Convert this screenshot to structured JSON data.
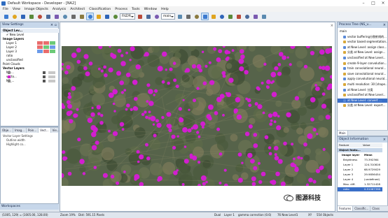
{
  "window": {
    "title": "Default Workspace - Developer - [NA2]",
    "controls": [
      "–",
      "□",
      "×"
    ]
  },
  "menu": [
    "File",
    "View",
    "Image Objects",
    "Analysis",
    "Architect",
    "Classification",
    "Process",
    "Tools",
    "Window",
    "Help"
  ],
  "toolbar": {
    "zoom_value": "FitZ/R",
    "mode_value": "main",
    "icons": [
      "new-workspace-icon",
      "open-icon",
      "save-icon",
      "import-icon",
      "export-icon",
      "undo-icon",
      "cut-icon",
      "copy-icon",
      "paste-icon",
      "settings-icon",
      "cursor-icon",
      "pan-hand-icon",
      "zoom-in-icon",
      "zoom-out-icon",
      "zoom-area-icon",
      "zoom-fit-icon",
      "refresh-icon",
      "layer-mixing-icon",
      "vector-icon",
      "pixel-view-icon",
      "object-view-icon",
      "outline-icon",
      "fill-icon",
      "class-view-icon",
      "process-icon",
      "stop-icon",
      "expand-icon",
      "collapse-icon"
    ]
  },
  "view_settings": {
    "title": "View Settings",
    "columns": [
      "Object Lev...",
      "Layer",
      "Vis",
      "Col"
    ],
    "rows": [
      {
        "label": "Object Lev...",
        "indent": 0,
        "bold": true
      },
      {
        "label": "✔ New Level",
        "indent": 1,
        "bold": false
      },
      {
        "label": "Image Layers",
        "indent": 0,
        "bold": true
      },
      {
        "label": "Layer 1",
        "indent": 1,
        "bold": false
      },
      {
        "label": "Layer 2",
        "indent": 1,
        "bold": false
      },
      {
        "label": "Layer 3",
        "indent": 1,
        "bold": false
      },
      {
        "label": "ratio",
        "indent": 1,
        "bold": false
      },
      {
        "label": "unclassified",
        "indent": 1,
        "bold": false
      },
      {
        "label": "Point Clouds",
        "indent": 0,
        "bold": false
      },
      {
        "label": "Vector Layers",
        "indent": 0,
        "bold": true
      },
      {
        "label": "NS-...",
        "indent": 1,
        "bold": false
      },
      {
        "label": "vecto...",
        "indent": 1,
        "bold": false
      },
      {
        "label": "NS_...",
        "indent": 1,
        "bold": false
      }
    ],
    "lower_tabs": [
      "Obje...",
      "Imag...",
      "Poin...",
      "Vect...",
      "Vie..."
    ],
    "lower_rows": [
      "Vector Layer Settings",
      "Outline width",
      "Highlight co..."
    ],
    "bottom_label": "Workspaces"
  },
  "process_tree": {
    "title": "Process Tree (NS_v...",
    "items": [
      "main",
      "vector buffering分割射线的...",
      "vector based segmentation...",
      "at New Level: assign class...",
      "分类 at New Level: assign...",
      "unclassified at New Level...",
      "create 9-layer convolution...",
      "train convolutional neural...",
      "save convolutional neural...",
      "apply convolutional neural...",
      "multi resolution: 30 [shape...",
      "at New Level: 分类",
      "unclassified at New Level...",
      "at New Level: convert ...",
      "分类 at New Level: export..."
    ],
    "bottom_tab": "Main"
  },
  "object_info": {
    "title": "Object Information",
    "header": [
      "Feature",
      "Value"
    ],
    "group": "Object featu...",
    "sub": [
      "Image layer",
      "Mean"
    ],
    "rows": [
      {
        "name": "Brightness",
        "value": "73.392364"
      },
      {
        "name": "Layer 1",
        "value": "124.310816"
      },
      {
        "name": "Layer 2",
        "value": "68.9729029"
      },
      {
        "name": "Layer 3",
        "value": "29.9856454"
      },
      {
        "name": "Layer 4",
        "value": "(undefined)"
      },
      {
        "name": "Max. diff.",
        "value": "1.32711428"
      },
      {
        "name": "ratio",
        "value": "0.51087398"
      }
    ],
    "tabs": [
      "Features",
      "Classific...",
      "Class De..."
    ]
  },
  "status": {
    "coords": "(1005, 129) = (1005.00, 128.00)",
    "zoom": "Zoom 19%",
    "dims": "Dist: 591.15 Pixels",
    "layer": "Dual",
    "layer_name": "Layer 1",
    "geo": "gamma correction (0.6)",
    "level": "76 New Level1",
    "objects": "554 Objects",
    "xy": "XY"
  },
  "watermark": "图源科技",
  "colors": {
    "panel_header": "#c7d7ea",
    "magenta": "#d21ed0",
    "selected": "#3a6fc8",
    "vegetation": "#56634a"
  }
}
